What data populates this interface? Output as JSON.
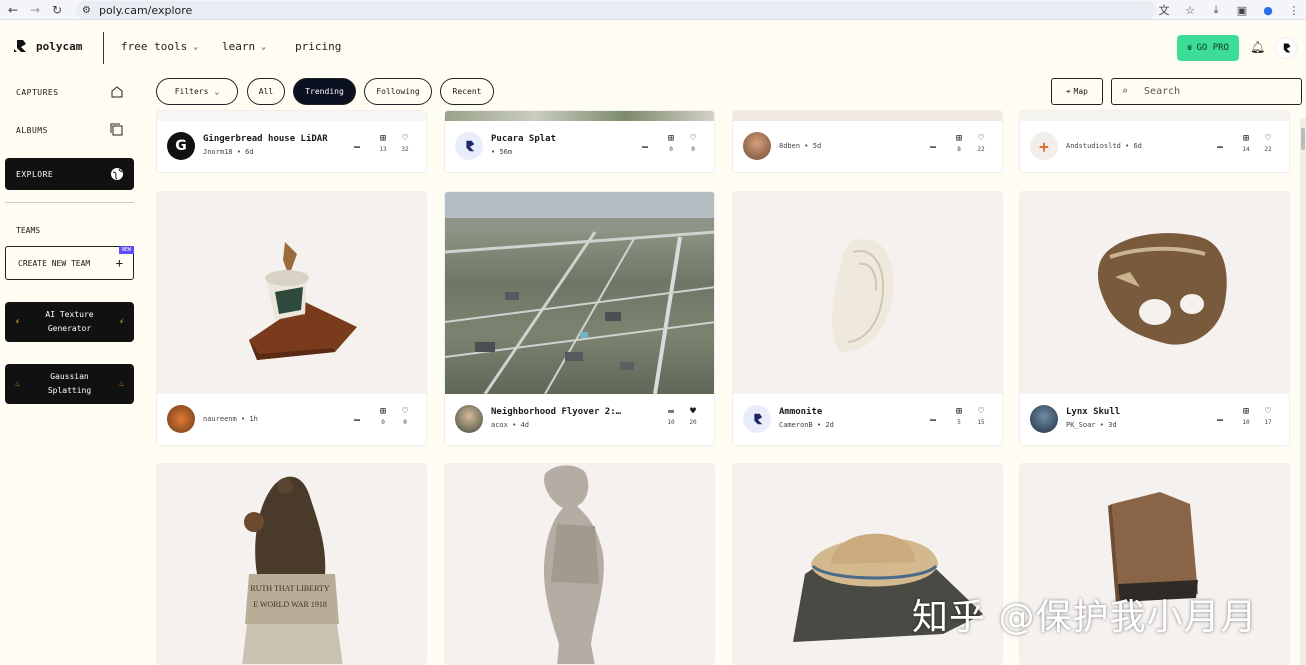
{
  "browser": {
    "url": "poly.cam/explore"
  },
  "header": {
    "brand": "polycam",
    "menu": [
      {
        "label": "free tools",
        "has_caret": true
      },
      {
        "label": "learn",
        "has_caret": true
      },
      {
        "label": "pricing",
        "has_caret": false
      }
    ],
    "go_pro_label": "GO PRO",
    "accent_color": "#3ddc97"
  },
  "sidebar": {
    "items": [
      {
        "label": "CAPTURES",
        "icon": "home-icon"
      },
      {
        "label": "ALBUMS",
        "icon": "stack-icon"
      },
      {
        "label": "EXPLORE",
        "icon": "globe-icon",
        "active": true
      }
    ],
    "teams_label": "TEAMS",
    "create_team_label": "CREATE NEW TEAM",
    "new_badge": "NEW",
    "promo1": {
      "line1": "AI Texture",
      "line2": "Generator"
    },
    "promo2": {
      "line1": "Gaussian",
      "line2": "Splatting"
    }
  },
  "filters": {
    "filters_label": "Filters",
    "tabs": [
      {
        "label": "All"
      },
      {
        "label": "Trending",
        "active": true
      },
      {
        "label": "Following"
      },
      {
        "label": "Recent"
      }
    ],
    "map_label": "Map",
    "search_placeholder": "Search"
  },
  "cards_row1": [
    {
      "title": "Gingerbread house LiDAR",
      "user": "Jnorm18",
      "time": "6d",
      "saves": "13",
      "likes": "32"
    },
    {
      "title": "Pucara Splat",
      "user": "",
      "time": "56m",
      "saves": "0",
      "likes": "0"
    },
    {
      "title": "",
      "user": "8dben",
      "time": "5d",
      "saves": "8",
      "likes": "22"
    },
    {
      "title": "",
      "user": "Andstudiosltd",
      "time": "6d",
      "saves": "14",
      "likes": "22"
    }
  ],
  "cards_row2": [
    {
      "title": "",
      "user": "naureenm",
      "time": "1h",
      "saves": "0",
      "likes": "0"
    },
    {
      "title": "Neighborhood Flyover 2:…",
      "user": "acox",
      "time": "4d",
      "saves": "10",
      "likes": "20",
      "liked": true
    },
    {
      "title": "Ammonite",
      "user": "CameronB",
      "time": "2d",
      "saves": "5",
      "likes": "15"
    },
    {
      "title": "Lynx Skull",
      "user": "PK_Soar",
      "time": "3d",
      "saves": "10",
      "likes": "17"
    }
  ],
  "statue_inscription": {
    "line1": "RUTH THAT LIBERTY",
    "line2": "E WORLD WAR 1918"
  },
  "watermark": "知乎 @保护我小月月"
}
